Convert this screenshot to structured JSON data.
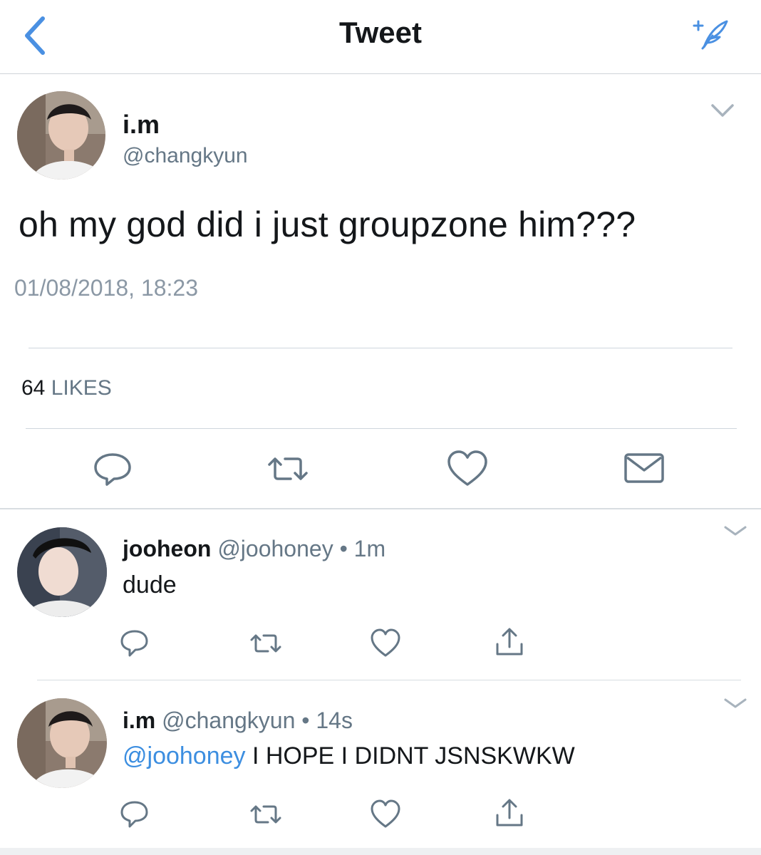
{
  "header": {
    "title": "Tweet"
  },
  "tweet": {
    "name": "i.m",
    "handle": "@changkyun",
    "text": "oh my god did i just groupzone him???",
    "timestamp": "01/08/2018, 18:23",
    "likes_count": "64",
    "likes_label": "LIKES"
  },
  "replies": [
    {
      "name": "jooheon",
      "handle": "@joohoney",
      "separator": "•",
      "time": "1m",
      "text": "dude",
      "mention": ""
    },
    {
      "name": "i.m",
      "handle": "@changkyun",
      "separator": "•",
      "time": "14s",
      "mention": "@joohoney",
      "text": " I HOPE I DIDNT JSNSKWKW"
    }
  ],
  "icons": {
    "back": "chevron-left-icon",
    "compose": "compose-sparkle-icon",
    "more": "chevron-down-icon",
    "reply": "reply-icon",
    "retweet": "retweet-icon",
    "like": "heart-icon",
    "dm": "envelope-icon",
    "share": "share-icon"
  },
  "colors": {
    "accent": "#4a90e2",
    "text": "#14171a",
    "secondary": "#657786",
    "mention": "#3c8ee0"
  }
}
